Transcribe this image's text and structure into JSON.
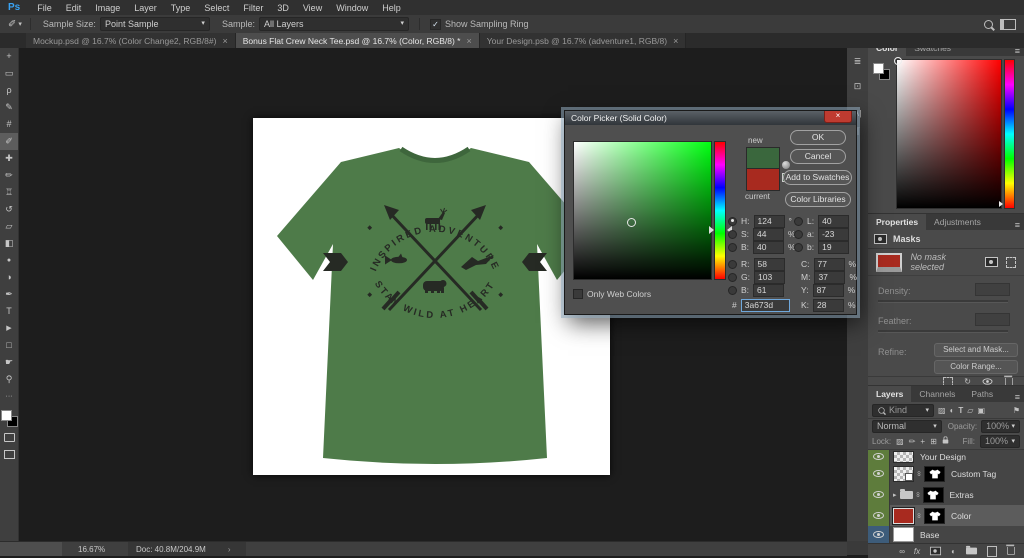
{
  "app_logo": "Ps",
  "menu": [
    "File",
    "Edit",
    "Image",
    "Layer",
    "Type",
    "Select",
    "Filter",
    "3D",
    "View",
    "Window",
    "Help"
  ],
  "options": {
    "sample_size_label": "Sample Size:",
    "sample_size_value": "Point Sample",
    "sample_label": "Sample:",
    "sample_value": "All Layers",
    "sampling_ring_label": "Show Sampling Ring"
  },
  "doc_tabs": [
    {
      "label": "Mockup.psd @ 16.7% (Color Change2, RGB/8#)"
    },
    {
      "label": "Bonus Flat Crew Neck Tee.psd @ 16.7% (Color, RGB/8) *"
    },
    {
      "label": "Your Design.psb @ 16.7% (adventure1, RGB/8)"
    }
  ],
  "tools": [
    {
      "name": "move-tool",
      "glyph": "+"
    },
    {
      "name": "marquee-tool",
      "glyph": "▭"
    },
    {
      "name": "lasso-tool",
      "glyph": "ρ"
    },
    {
      "name": "quick-selection-tool",
      "glyph": "✎"
    },
    {
      "name": "crop-tool",
      "glyph": "#"
    },
    {
      "name": "eyedropper-tool",
      "glyph": "✐"
    },
    {
      "name": "healing-brush-tool",
      "glyph": "✚"
    },
    {
      "name": "brush-tool",
      "glyph": "✏"
    },
    {
      "name": "clone-stamp-tool",
      "glyph": "♖"
    },
    {
      "name": "history-brush-tool",
      "glyph": "↺"
    },
    {
      "name": "eraser-tool",
      "glyph": "▱"
    },
    {
      "name": "gradient-tool",
      "glyph": "◧"
    },
    {
      "name": "blur-tool",
      "glyph": "●"
    },
    {
      "name": "dodge-tool",
      "glyph": "◑"
    },
    {
      "name": "pen-tool",
      "glyph": "✒"
    },
    {
      "name": "type-tool",
      "glyph": "T"
    },
    {
      "name": "path-selection-tool",
      "glyph": "▶"
    },
    {
      "name": "shape-tool",
      "glyph": "□"
    },
    {
      "name": "hand-tool",
      "glyph": "☛"
    },
    {
      "name": "zoom-tool",
      "glyph": "⚲"
    },
    {
      "name": "edit-toolbar",
      "glyph": "···"
    }
  ],
  "design": {
    "top_text": "INSPIRED ADVENTURE",
    "bottom_text": "STAY WILD AT HEART"
  },
  "colors": {
    "shirt_green": "#4e7b49",
    "picked_green": "#3a673d",
    "current_red": "#a82a1f"
  },
  "color_picker": {
    "title": "Color Picker (Solid Color)",
    "new_label": "new",
    "current_label": "current",
    "ok": "OK",
    "cancel": "Cancel",
    "add_to_swatches": "Add to Swatches",
    "color_libraries": "Color Libraries",
    "only_web_colors": "Only Web Colors",
    "left_fields": [
      {
        "label": "H:",
        "value": "124",
        "unit": "°"
      },
      {
        "label": "S:",
        "value": "44",
        "unit": "%"
      },
      {
        "label": "B:",
        "value": "40",
        "unit": "%"
      },
      {
        "label": "R:",
        "value": "58",
        "unit": ""
      },
      {
        "label": "G:",
        "value": "103",
        "unit": ""
      },
      {
        "label": "B:",
        "value": "61",
        "unit": ""
      }
    ],
    "right_fields": [
      {
        "label": "L:",
        "value": "40",
        "unit": ""
      },
      {
        "label": "a:",
        "value": "-23",
        "unit": ""
      },
      {
        "label": "b:",
        "value": "19",
        "unit": ""
      },
      {
        "label": "C:",
        "value": "77",
        "unit": "%"
      },
      {
        "label": "M:",
        "value": "37",
        "unit": "%"
      },
      {
        "label": "Y:",
        "value": "87",
        "unit": "%"
      },
      {
        "label": "K:",
        "value": "28",
        "unit": "%"
      }
    ],
    "hex_label": "#",
    "hex_value": "3a673d"
  },
  "panels": {
    "color": {
      "tab_color": "Color",
      "tab_swatches": "Swatches"
    },
    "properties": {
      "tab_properties": "Properties",
      "tab_adjustments": "Adjustments",
      "header": "Masks",
      "empty": "No mask selected",
      "density": "Density:",
      "feather": "Feather:",
      "refine": "Refine:",
      "select_and_mask": "Select and Mask...",
      "color_range": "Color Range..."
    },
    "layers": {
      "tab_layers": "Layers",
      "tab_channels": "Channels",
      "tab_paths": "Paths",
      "kind": "Kind",
      "blend_mode": "Normal",
      "opacity_label": "Opacity:",
      "opacity": "100%",
      "lock_label": "Lock:",
      "fill_label": "Fill:",
      "fill": "100%",
      "rows": [
        {
          "name": "Your Design"
        },
        {
          "name": "Custom Tag"
        },
        {
          "name": "Extras"
        },
        {
          "name": "Color"
        },
        {
          "name": "Base"
        }
      ]
    },
    "strip": {
      "character": "A|",
      "paragraph": "¶"
    }
  },
  "glyphs": {
    "close": "×",
    "dropdown": "▾",
    "collapse": "»",
    "chevron": "›",
    "panel_menu": "≡",
    "check": "✓",
    "image": "▨",
    "adjustment": "◐",
    "type": "T",
    "shape": "▱",
    "smart_object": "▣",
    "pin": "⚑",
    "lock_checker": "▨",
    "lock_brush": "✏",
    "lock_move": "+",
    "lock_artboard": "⊞",
    "chain": "∞",
    "fx": "fx",
    "apply": "↻",
    "expander": "▸",
    "strip_icon1": "≣",
    "strip_icon2": "⊡"
  },
  "status": {
    "zoom": "16.67%",
    "doc": "Doc: 40.8M/204.9M"
  }
}
